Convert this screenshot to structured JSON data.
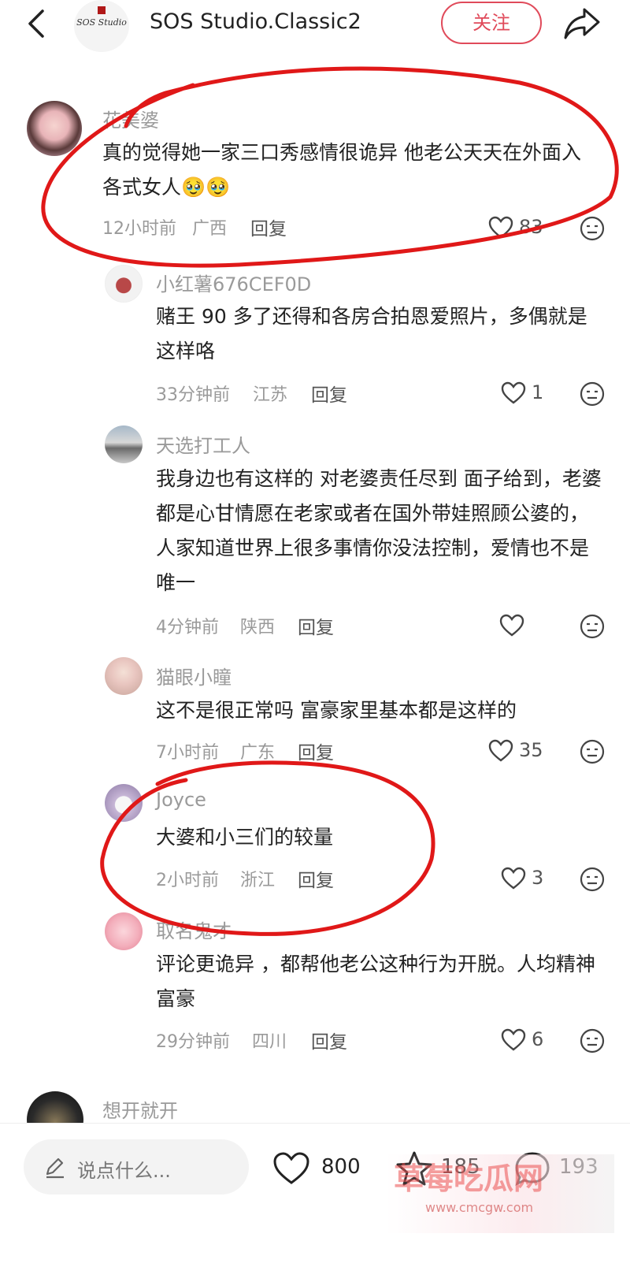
{
  "header": {
    "title": "SOS Studio.Classic2",
    "follow_label": "关注",
    "logo_text": "SOS Studio"
  },
  "comments": [
    {
      "user": "花美婆",
      "text": "真的觉得她一家三口秀感情很诡异 他老公天天在外面入各式女人🥹🥹",
      "time": "12小时前",
      "region": "广西",
      "reply": "回复",
      "likes": "83"
    },
    {
      "user": "小红薯676CEF0D",
      "text": "赌王 90 多了还得和各房合拍恩爱照片，多偶就是这样咯",
      "time": "33分钟前",
      "region": "江苏",
      "reply": "回复",
      "likes": "1"
    },
    {
      "user": "天选打工人",
      "text": "我身边也有这样的 对老婆责任尽到 面子给到，老婆都是心甘情愿在老家或者在国外带娃照顾公婆的， 人家知道世界上很多事情你没法控制，爱情也不是唯一",
      "time": "4分钟前",
      "region": "陕西",
      "reply": "回复",
      "likes": ""
    },
    {
      "user": "猫眼小瞳",
      "text": "这不是很正常吗 富豪家里基本都是这样的",
      "time": "7小时前",
      "region": "广东",
      "reply": "回复",
      "likes": "35"
    },
    {
      "user": "Joyce",
      "text": "大婆和小三们的较量",
      "time": "2小时前",
      "region": "浙江",
      "reply": "回复",
      "likes": "3"
    },
    {
      "user": "取名鬼才",
      "text": "评论更诡异 ，都帮他老公这种行为开脱。人均精神富豪",
      "time": "29分钟前",
      "region": "四川",
      "reply": "回复",
      "likes": "6"
    },
    {
      "user": "想开就开"
    }
  ],
  "bottom": {
    "input_placeholder": "说点什么...",
    "likes": "800",
    "stars": "185",
    "comments": "193"
  },
  "watermark": {
    "text": "草莓吃瓜网",
    "url": "www.cmcgw.com"
  },
  "colors": {
    "follow": "#e04a5a",
    "annotation": "#e01818"
  }
}
